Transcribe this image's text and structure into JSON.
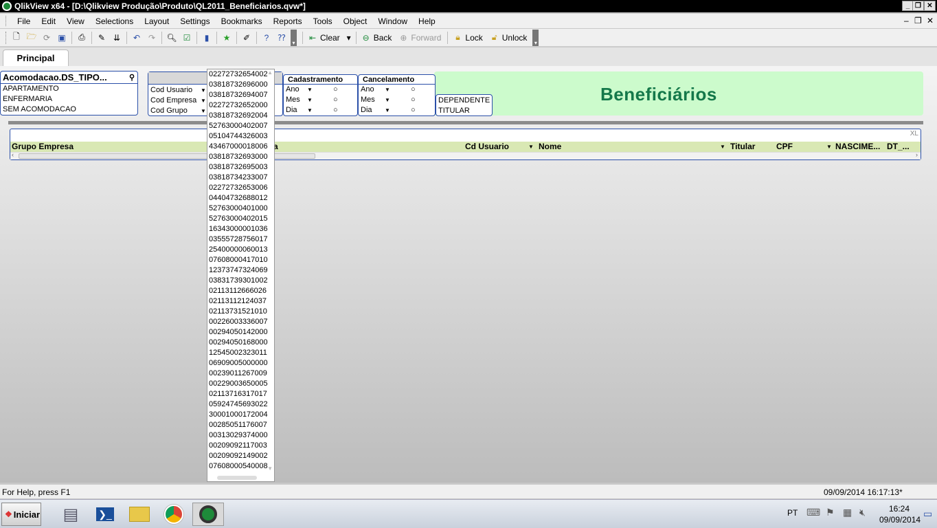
{
  "window": {
    "title": "QlikView x64 - [D:\\Qlikview Produção\\Produto\\QL2011_Beneficiarios.qvw*]",
    "controls": [
      "_",
      "❐",
      "✕"
    ],
    "mdi_controls": [
      "–",
      "❐",
      "✕"
    ]
  },
  "menu": [
    "File",
    "Edit",
    "View",
    "Selections",
    "Layout",
    "Settings",
    "Bookmarks",
    "Reports",
    "Tools",
    "Object",
    "Window",
    "Help"
  ],
  "toolbar": {
    "clear_label": "Clear",
    "back_label": "Back",
    "forward_label": "Forward",
    "lock_label": "Lock",
    "unlock_label": "Unlock"
  },
  "sheet_tabs": [
    "Principal"
  ],
  "acomodacao": {
    "title": "Acomodacao.DS_TIPO...",
    "items": [
      "APARTAMENTO",
      "ENFERMARIA",
      "SEM ACOMODACAO"
    ]
  },
  "codes_box": {
    "items": [
      "Cod Usuario",
      "Cod Empresa",
      "Cod Grupo"
    ]
  },
  "cadastramento": {
    "title": "Cadastramento",
    "items": [
      "Ano",
      "Mes",
      "Dia"
    ]
  },
  "cancelamento": {
    "title": "Cancelamento",
    "items": [
      "Ano",
      "Mes",
      "Dia"
    ]
  },
  "titular_box": {
    "items": [
      "DEPENDENTE",
      "TITULAR"
    ]
  },
  "banner": {
    "text": "Beneficiários"
  },
  "table": {
    "xl_label": "XL",
    "columns": [
      "Grupo Empresa",
      "a",
      "Cd Usuario",
      "Nome",
      "Titular",
      "CPF",
      "NASCIME...",
      "DT_..."
    ]
  },
  "dropdown_values": [
    "02272732654002",
    "03818732696000",
    "03818732694007",
    "02272732652000",
    "03818732692004",
    "52763000402007",
    "05104744326003",
    "43467000018006",
    "03818732693000",
    "03818732695003",
    "03818734233007",
    "02272732653006",
    "04404732688012",
    "52763000401000",
    "52763000402015",
    "16343000001036",
    "03555728756017",
    "25400000060013",
    "07608000417010",
    "12373747324069",
    "03831739301002",
    "02113112666026",
    "02113112124037",
    "02113731521010",
    "00226003336007",
    "00294050142000",
    "00294050168000",
    "12545002323011",
    "06909005000000",
    "00239011267009",
    "00229003650005",
    "02113716317017",
    "05924745693022",
    "30001000172004",
    "00285051176007",
    "00313029374000",
    "00209092117003",
    "00209092149002",
    "07608000540008"
  ],
  "status": {
    "help_text": "For Help, press F1",
    "timestamp": "09/09/2014 16:17:13*"
  },
  "taskbar": {
    "start_label": "Iniciar",
    "language": "PT",
    "time": "16:24",
    "date": "09/09/2014"
  }
}
